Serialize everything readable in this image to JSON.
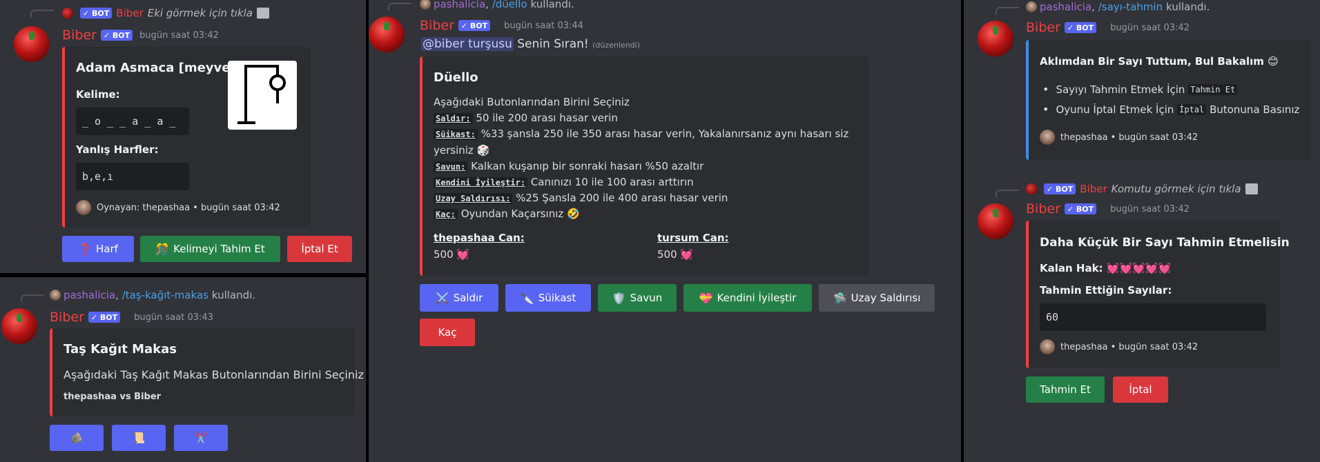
{
  "panel1": {
    "hangman": {
      "reply_user": "Biber",
      "reply_text": "Eki görmek için tıkla",
      "bot_label": "✓ BOT",
      "author": "Biber",
      "time": "bugün saat 03:42",
      "title": "Adam Asmaca [meyve]",
      "word_label": "Kelime:",
      "word_value": "_ o _ _ a _ a _",
      "wrong_label": "Yanlış Harfler:",
      "wrong_value": "b,e,ı",
      "footer": "Oynayan: thepashaa • bugün saat 03:42",
      "buttons": [
        {
          "emoji": "❓",
          "label": "Harf"
        },
        {
          "emoji": "🎊",
          "label": "Kelimeyi Tahim Et"
        },
        {
          "emoji": "",
          "label": "İptal Et"
        }
      ]
    },
    "rps": {
      "reply_user": "pashalicia",
      "reply_cmd": "/taş-kağıt-makas",
      "reply_suffix": "kullandı.",
      "author": "Biber",
      "bot_label": "✓ BOT",
      "time": "bugün saat 03:43",
      "title": "Taş Kağıt Makas",
      "desc": "Aşağıdaki Taş Kağıt Makas Butonlarından Birini Seçiniz",
      "vs": "thepashaa vs Biber",
      "buttons": [
        "🪨",
        "📜",
        "✂️"
      ]
    }
  },
  "panel2": {
    "reply_user": "pashalicia",
    "reply_cmd": "/düello",
    "reply_suffix": "kullandı.",
    "author": "Biber",
    "bot_label": "✓ BOT",
    "time": "bugün saat 03:44",
    "mention": "@biber turşusu",
    "content": "Senin Sıran!",
    "edited": "(düzenlendi)",
    "title": "Düello",
    "intro": "Aşağıdaki Butonlarından Birini Seçiniz",
    "lines": [
      {
        "key": "Saldır:",
        "text": "50 ile 200 arası hasar verin"
      },
      {
        "key": "Süikast:",
        "text": "%33 şansla 250 ile 350 arası hasar verin, Yakalanırsanız aynı hasarı siz"
      },
      {
        "key": "",
        "text": "yersiniz 🎲"
      },
      {
        "key": "Savun:",
        "text": "Kalkan kuşanıp bir sonraki hasarı %50 azaltır"
      },
      {
        "key": "Kendini İyileştir:",
        "text": "Canınızı 10 ile 100 arası arttırın"
      },
      {
        "key": "Uzay Saldırısı:",
        "text": "%25 Şansla 200 ile 400 arası hasar verin"
      },
      {
        "key": "Kaç:",
        "text": "Oyundan Kaçarsınız 🤣"
      }
    ],
    "hp1_label": "thepashaa Can:",
    "hp1_value": "500 💓",
    "hp2_label": "tursum Can:",
    "hp2_value": "500 💓",
    "buttons": [
      {
        "emoji": "⚔️",
        "label": "Saldır"
      },
      {
        "emoji": "🔪",
        "label": "Süikast"
      },
      {
        "emoji": "🛡️",
        "label": "Savun"
      },
      {
        "emoji": "💝",
        "label": "Kendini İyileştir"
      },
      {
        "emoji": "🛸",
        "label": "Uzay Saldırısı"
      },
      {
        "emoji": "",
        "label": "Kaç"
      }
    ]
  },
  "panel3": {
    "guess1": {
      "reply_user": "pashalicia",
      "reply_cmd": "/sayı-tahmin",
      "reply_suffix": "kullandı.",
      "author": "Biber",
      "bot_label": "✓ BOT",
      "time": "bugün saat 03:42",
      "title": "Aklımdan Bir Sayı Tuttum, Bul Bakalım 😊",
      "bullets": [
        {
          "pre": "Sayıyı Tahmin Etmek İçin",
          "code": "Tahmin Et",
          "post": ""
        },
        {
          "pre": "Oyunu İptal Etmek İçin",
          "code": "İptal",
          "post": "Butonuna Basınız"
        }
      ],
      "footer": "thepashaa • bugün saat 03:42"
    },
    "guess2": {
      "reply_user": "Biber",
      "reply_text": "Komutu görmek için tıkla",
      "bot_label": "✓ BOT",
      "author": "Biber",
      "time": "bugün saat 03:42",
      "title": "Daha Küçük Bir Sayı Tahmin Etmelisin",
      "lives_label": "Kalan Hak:",
      "lives_value": "💓💓💓💓💓",
      "guesses_label": "Tahmin Ettiğin Sayılar:",
      "guesses_value": "60",
      "footer": "thepashaa • bugün saat 03:42",
      "buttons": [
        {
          "label": "Tahmin Et"
        },
        {
          "label": "İptal"
        }
      ]
    }
  }
}
